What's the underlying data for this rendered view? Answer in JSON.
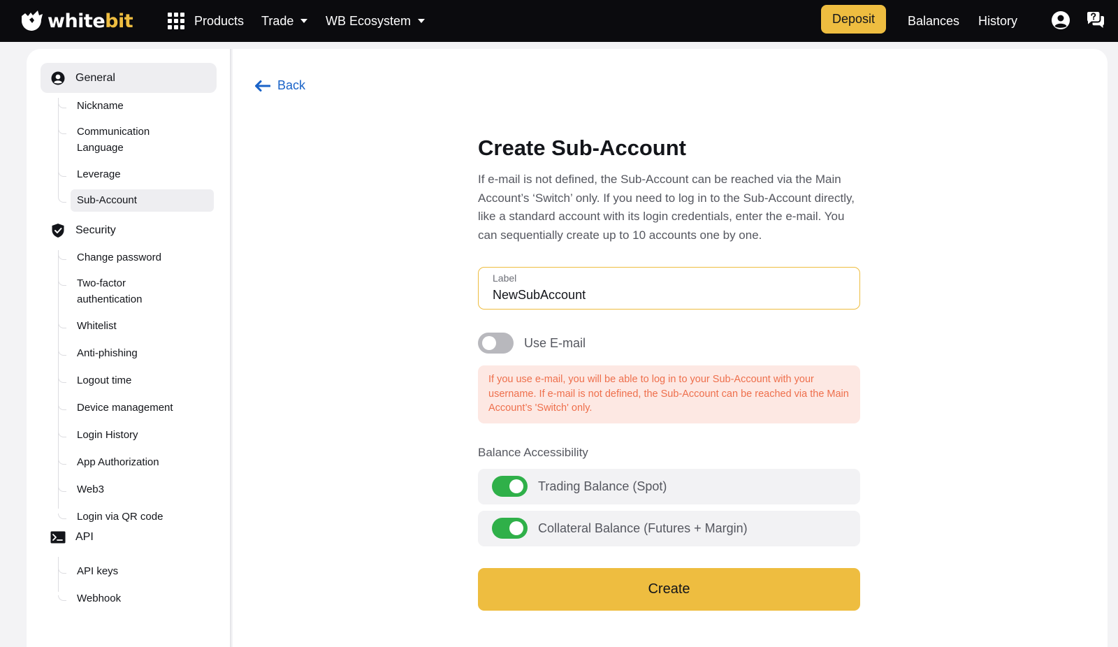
{
  "brand": {
    "name_part1": "white",
    "name_part2": "bit",
    "accent_color": "#eebd40"
  },
  "topnav": {
    "products_label": "Products",
    "trade_label": "Trade",
    "ecosystem_label": "WB Ecosystem",
    "deposit_label": "Deposit",
    "balances_label": "Balances",
    "history_label": "History",
    "icons": [
      "grid-icon",
      "chevron-down-icon",
      "user-icon",
      "support-chat-icon"
    ]
  },
  "sidebar": {
    "sections": [
      {
        "label": "General",
        "icon": "user-circle-icon",
        "active": true,
        "items": [
          {
            "label": "Nickname"
          },
          {
            "label": "Communication Language"
          },
          {
            "label": "Leverage"
          },
          {
            "label": "Sub-Account",
            "active": true
          }
        ]
      },
      {
        "label": "Security",
        "icon": "shield-check-icon",
        "items": [
          {
            "label": "Change password"
          },
          {
            "label": "Two-factor authentication"
          },
          {
            "label": "Whitelist"
          },
          {
            "label": "Anti-phishing"
          },
          {
            "label": "Logout time"
          },
          {
            "label": "Device management"
          },
          {
            "label": "Login History"
          },
          {
            "label": "App Authorization"
          },
          {
            "label": "Web3"
          },
          {
            "label": "Login via QR code"
          }
        ]
      },
      {
        "label": "API",
        "icon": "terminal-icon",
        "items": [
          {
            "label": "API keys"
          },
          {
            "label": "Webhook"
          }
        ]
      }
    ]
  },
  "main": {
    "back_label": "Back",
    "title": "Create Sub-Account",
    "description": "If e-mail is not defined, the Sub-Account can be reached via the Main Account’s ‘Switch’ only. If you need to log in to the Sub-Account directly, like a standard account with its login credentials, enter the e-mail. You can sequentially create up to 10 accounts one by one.",
    "label_field": {
      "label": "Label",
      "value": "NewSubAccount"
    },
    "use_email": {
      "label": "Use E-mail",
      "enabled": false
    },
    "email_warning": "If you use e-mail, you will be able to log in to your Sub-Account with your username. If e-mail is not defined, the Sub-Account can be reached via the Main Account’s 'Switch' only.",
    "balance_accessibility": {
      "title": "Balance Accessibility",
      "options": [
        {
          "label": "Trading Balance (Spot)",
          "enabled": true
        },
        {
          "label": "Collateral Balance (Futures + Margin)",
          "enabled": true
        }
      ]
    },
    "create_label": "Create"
  },
  "colors": {
    "warning_text": "#ee6f4c",
    "warning_bg": "#fde8e3",
    "toggle_on": "#2fb049",
    "link": "#1a63c8"
  }
}
